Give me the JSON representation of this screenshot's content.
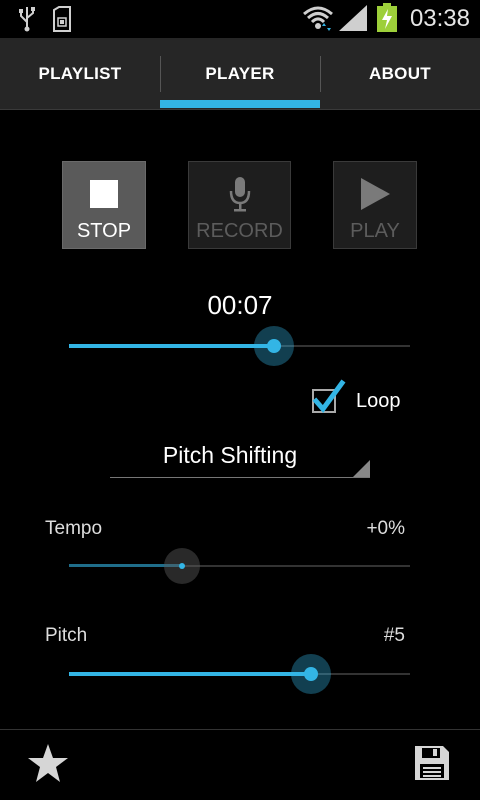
{
  "status_bar": {
    "time": "03:38",
    "icons": [
      "usb-icon",
      "sd-card-icon",
      "wifi-icon",
      "signal-icon",
      "battery-charging-icon"
    ]
  },
  "tabs": [
    {
      "label": "PLAYLIST",
      "selected": false
    },
    {
      "label": "PLAYER",
      "selected": true
    },
    {
      "label": "ABOUT",
      "selected": false
    }
  ],
  "transport": {
    "stop": {
      "label": "STOP",
      "icon": "stop-icon",
      "state": "active"
    },
    "record": {
      "label": "RECORD",
      "icon": "microphone-icon",
      "state": "disabled"
    },
    "play": {
      "label": "PLAY",
      "icon": "play-icon",
      "state": "disabled"
    }
  },
  "player": {
    "time": "00:07",
    "progress_fraction": 0.6,
    "loop_label": "Loop",
    "loop_checked": true
  },
  "mode_spinner": {
    "selected": "Pitch Shifting"
  },
  "tempo": {
    "label": "Tempo",
    "value": "+0%",
    "level_fraction": 0.33
  },
  "pitch": {
    "label": "Pitch",
    "value": "#5",
    "level_fraction": 0.71
  },
  "bottom_bar": {
    "icons": [
      "star-icon",
      "save-icon"
    ]
  },
  "colors": {
    "accent": "#33b5e5",
    "tab_bar": "#262626",
    "background": "#000000"
  }
}
